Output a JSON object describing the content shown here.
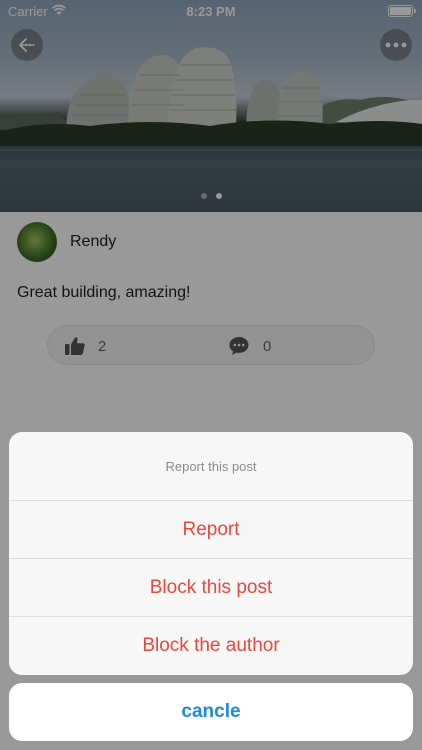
{
  "status_bar": {
    "carrier": "Carrier",
    "time": "8:23 PM"
  },
  "gallery": {
    "page_count": 2,
    "active_page": 2
  },
  "post": {
    "author_name": "Rendy",
    "text": "Great building, amazing!",
    "like_count": "2",
    "comment_count": "0"
  },
  "action_sheet": {
    "title": "Report this post",
    "items": [
      {
        "label": "Report"
      },
      {
        "label": "Block this post"
      },
      {
        "label": "Block the author"
      }
    ],
    "cancel_label": "cancle"
  },
  "colors": {
    "destructive": "#e8473e",
    "cancel": "#1c8bd9"
  }
}
